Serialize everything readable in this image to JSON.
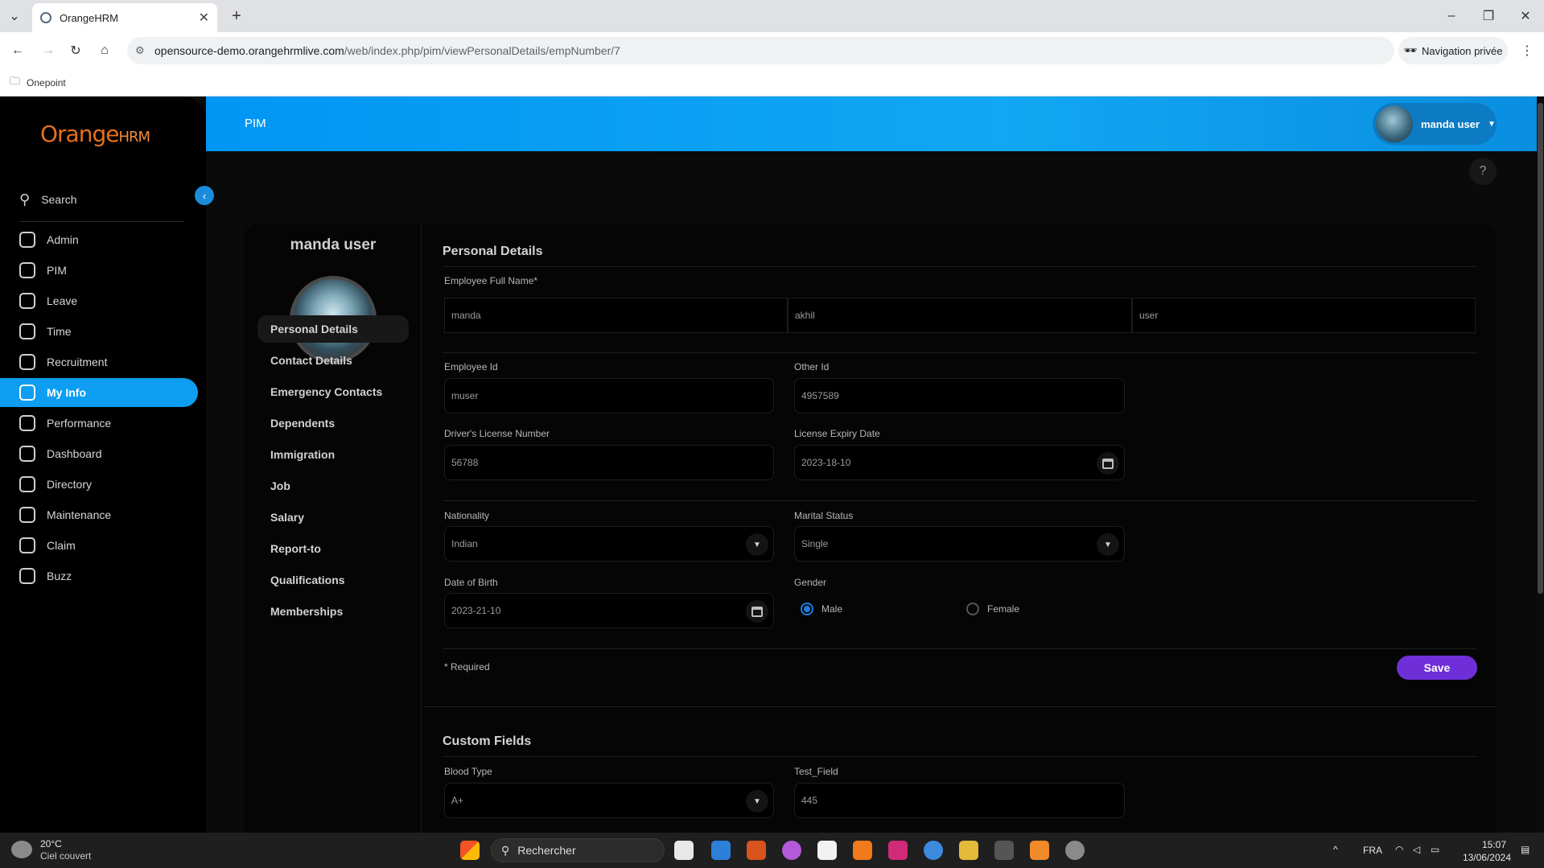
{
  "browser": {
    "tab_title": "OrangeHRM",
    "url_domain": "opensource-demo.orangehrmlive.com",
    "url_path": "/web/index.php/pim/viewPersonalDetails/empNumber/7",
    "private_label": "Navigation privée",
    "bookmark": "Onepoint"
  },
  "app": {
    "logo_main": "Orange",
    "logo_sub": "HRM",
    "module": "PIM",
    "user_name": "manda user",
    "help": "?"
  },
  "sidebar": {
    "search": "Search",
    "items": [
      {
        "label": "Admin",
        "icon": "admin-icon"
      },
      {
        "label": "PIM",
        "icon": "pim-icon"
      },
      {
        "label": "Leave",
        "icon": "leave-icon"
      },
      {
        "label": "Time",
        "icon": "time-icon"
      },
      {
        "label": "Recruitment",
        "icon": "recruitment-icon"
      },
      {
        "label": "My Info",
        "icon": "my-info-icon"
      },
      {
        "label": "Performance",
        "icon": "performance-icon"
      },
      {
        "label": "Dashboard",
        "icon": "dashboard-icon"
      },
      {
        "label": "Directory",
        "icon": "directory-icon"
      },
      {
        "label": "Maintenance",
        "icon": "maintenance-icon"
      },
      {
        "label": "Claim",
        "icon": "claim-icon"
      },
      {
        "label": "Buzz",
        "icon": "buzz-icon"
      }
    ],
    "active": "My Info"
  },
  "profile": {
    "name": "manda user",
    "tabs": [
      "Personal Details",
      "Contact Details",
      "Emergency Contacts",
      "Dependents",
      "Immigration",
      "Job",
      "Salary",
      "Report-to",
      "Qualifications",
      "Memberships"
    ]
  },
  "personal": {
    "title": "Personal Details",
    "full_name_label": "Employee Full Name*",
    "first_name": "manda",
    "middle_name": "akhil",
    "last_name": "user",
    "employee_id_label": "Employee Id",
    "employee_id": "muser",
    "other_id_label": "Other Id",
    "other_id": "4957589",
    "license_label": "Driver's License Number",
    "license": "56788",
    "expiry_label": "License Expiry Date",
    "expiry": "2023-18-10",
    "nationality_label": "Nationality",
    "nationality": "Indian",
    "marital_label": "Marital Status",
    "marital": "Single",
    "dob_label": "Date of Birth",
    "dob": "2023-21-10",
    "gender_label": "Gender",
    "gender_male": "Male",
    "gender_female": "Female",
    "gender_selected": "Male",
    "required_note": "* Required",
    "save": "Save"
  },
  "custom": {
    "title": "Custom Fields",
    "blood_label": "Blood Type",
    "blood": "A+",
    "test_label": "Test_Field",
    "test": "445"
  },
  "taskbar": {
    "temp": "20°C",
    "weather": "Ciel couvert",
    "search": "Rechercher",
    "lang": "FRA",
    "time": "15:07",
    "date": "13/06/2024"
  },
  "colors": {
    "active_nav": "#0d9ef2",
    "header": "#0096f4",
    "save_button": "#6f2fd8",
    "radio_selected": "#1a7fe0"
  }
}
